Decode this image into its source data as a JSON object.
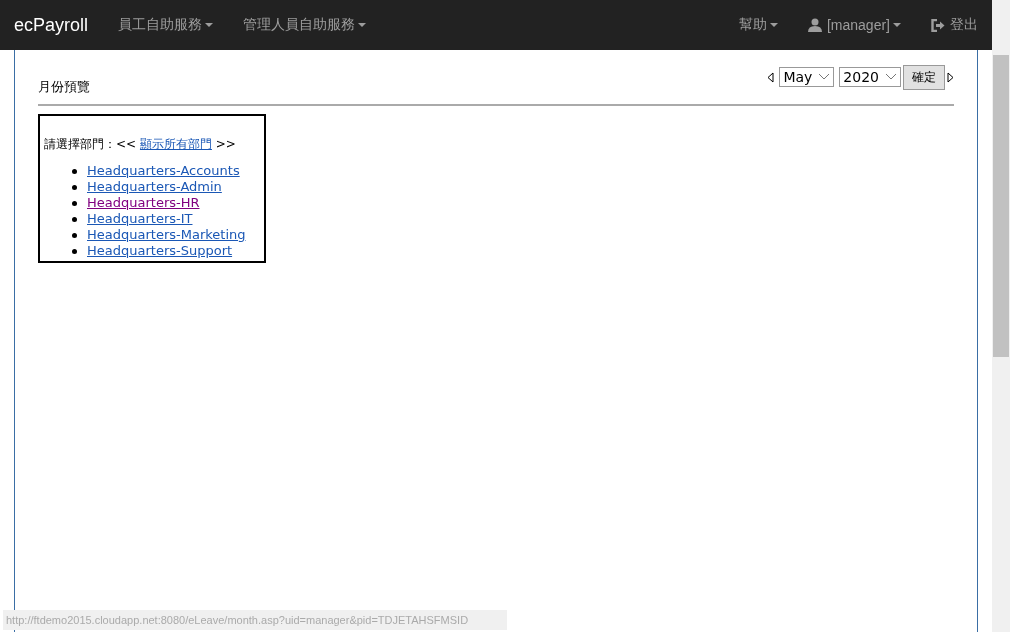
{
  "navbar": {
    "brand": "ecPayroll",
    "menus": [
      {
        "label": "員工自助服務"
      },
      {
        "label": "管理人員自助服務"
      }
    ],
    "right": [
      {
        "kind": "help",
        "label": "幫助"
      },
      {
        "kind": "user",
        "label": "[manager]"
      },
      {
        "kind": "logout",
        "label": "登出"
      }
    ]
  },
  "page": {
    "title": "月份預覽",
    "month": "May",
    "year": "2020",
    "confirm": "確定"
  },
  "departments": {
    "prompt": "請選擇部門：<<",
    "show_all": "顯示所有部門",
    "prompt_end": ">>",
    "items": [
      {
        "label": "Headquarters-Accounts",
        "visited": false
      },
      {
        "label": "Headquarters-Admin",
        "visited": false
      },
      {
        "label": "Headquarters-HR",
        "visited": true
      },
      {
        "label": "Headquarters-IT",
        "visited": false
      },
      {
        "label": "Headquarters-Marketing",
        "visited": false
      },
      {
        "label": "Headquarters-Support",
        "visited": false
      }
    ]
  },
  "status_bar": {
    "url": "http://ftdemo2015.cloudapp.net:8080/eLeave/month.asp?uid=manager&pid=TDJETAHSFMSID"
  }
}
